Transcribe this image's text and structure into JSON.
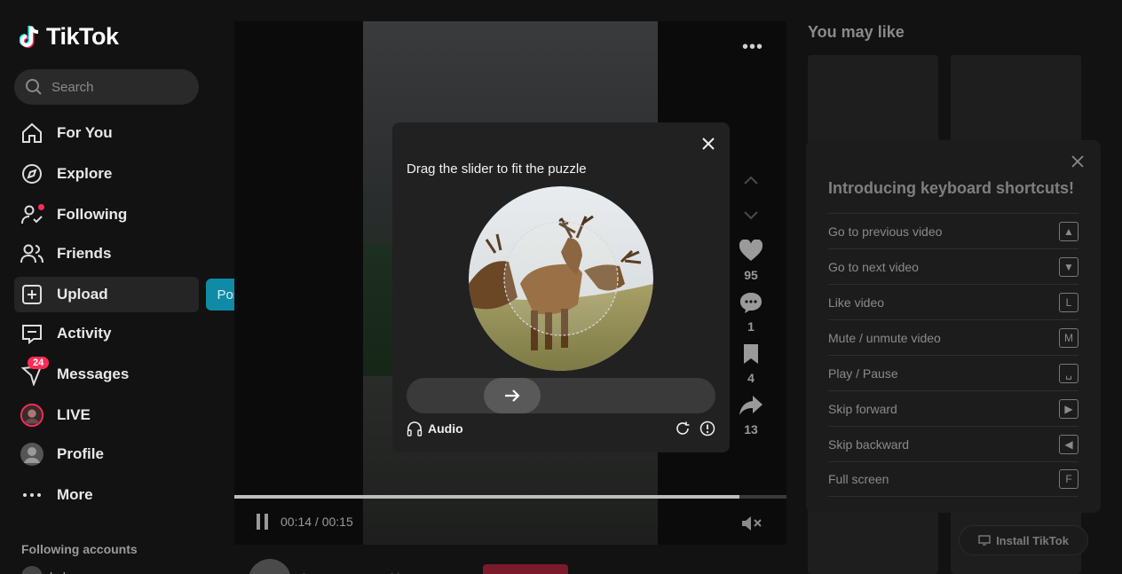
{
  "app": {
    "name": "TikTok"
  },
  "search": {
    "placeholder": "Search"
  },
  "nav": [
    {
      "label": "For You",
      "icon": "home-icon"
    },
    {
      "label": "Explore",
      "icon": "compass-icon"
    },
    {
      "label": "Following",
      "icon": "following-icon"
    },
    {
      "label": "Friends",
      "icon": "friends-icon"
    },
    {
      "label": "Upload",
      "icon": "upload-icon"
    },
    {
      "label": "Activity",
      "icon": "activity-icon"
    },
    {
      "label": "Messages",
      "icon": "messages-icon",
      "badge": "24"
    },
    {
      "label": "LIVE",
      "icon": "live-icon"
    },
    {
      "label": "Profile",
      "icon": "profile-icon"
    },
    {
      "label": "More",
      "icon": "more-icon"
    }
  ],
  "upload_tooltip": "Post video",
  "following_accounts": {
    "title": "Following accounts",
    "first": "koko"
  },
  "video": {
    "time": "00:14 / 00:15",
    "progress": 0.915,
    "likes": "95",
    "comments": "1",
    "saves": "4",
    "shares": "13",
    "author": "banyuwangifyp"
  },
  "right": {
    "title": "You may like",
    "install": "Install TikTok"
  },
  "shortcuts": {
    "title": "Introducing keyboard shortcuts!",
    "items": [
      {
        "label": "Go to previous video",
        "key": "▲"
      },
      {
        "label": "Go to next video",
        "key": "▼"
      },
      {
        "label": "Like video",
        "key": "L"
      },
      {
        "label": "Mute / unmute video",
        "key": "M"
      },
      {
        "label": "Play / Pause",
        "key": "␣"
      },
      {
        "label": "Skip forward",
        "key": "▶"
      },
      {
        "label": "Skip backward",
        "key": "◀"
      },
      {
        "label": "Full screen",
        "key": "F"
      }
    ]
  },
  "captcha": {
    "title": "Drag the slider to fit the puzzle",
    "audio": "Audio",
    "slider_position": 0.25
  },
  "colors": {
    "brand_red": "#fe2c55",
    "tooltip": "#0f8ba6"
  }
}
